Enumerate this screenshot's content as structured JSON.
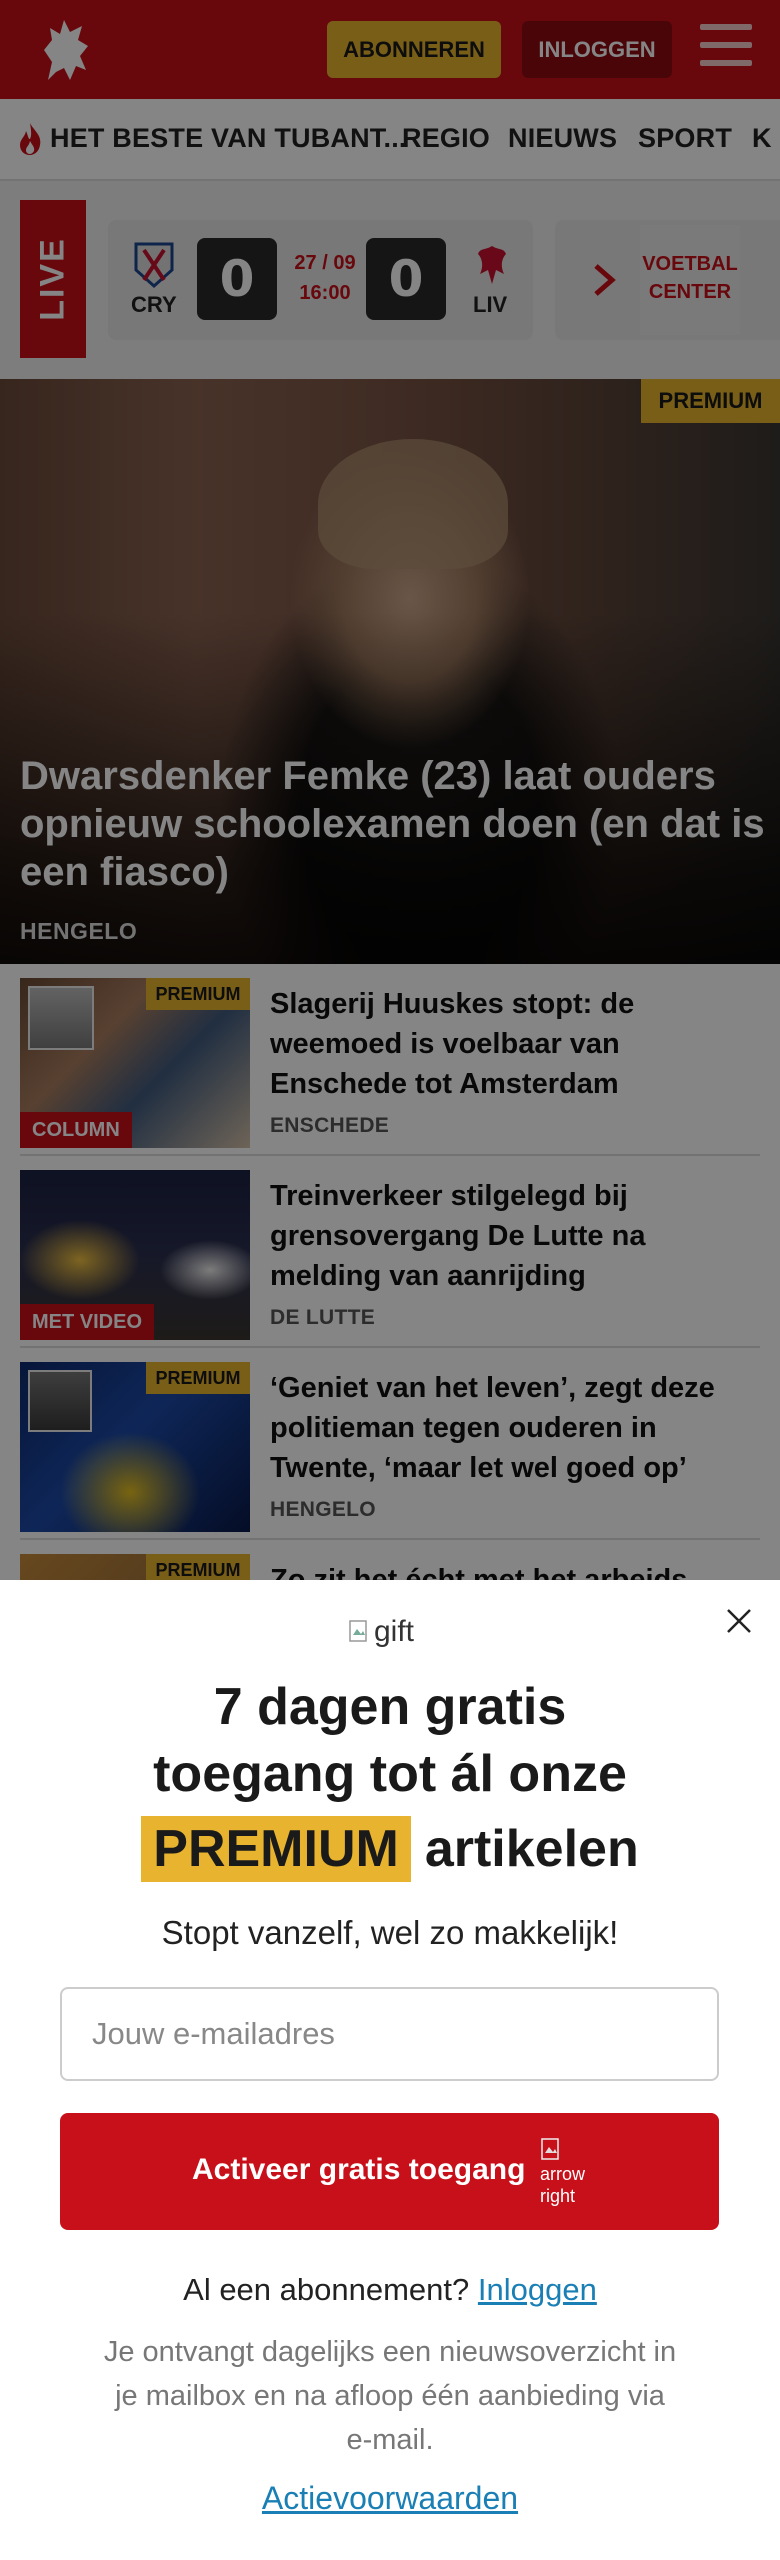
{
  "header": {
    "subscribe_label": "ABONNEREN",
    "login_label": "INLOGGEN",
    "brand_color": "#c8101a"
  },
  "nav": {
    "items": [
      "HET BESTE VAN TUBANT...",
      "REGIO",
      "NIEUWS",
      "SPORT",
      "K"
    ]
  },
  "live": {
    "tag": "LIVE",
    "match": {
      "home_code": "CRY",
      "home_score": "0",
      "date": "27 / 09",
      "time": "16:00",
      "away_score": "0",
      "away_code": "LIV"
    },
    "voetbal_center": [
      "VOETBAL",
      "CENTER"
    ]
  },
  "hero": {
    "badge": "PREMIUM",
    "title": "Dwarsdenker Femke (23) laat ouders opnieuw schoolexamen doen (en dat is een fiasco)",
    "kicker": "HENGELO"
  },
  "articles": [
    {
      "badge": "PREMIUM",
      "label": "COLUMN",
      "title": "Slagerij Huuskes stopt: de weemoed is voelbaar van Enschede tot Amsterdam",
      "kicker": "ENSCHEDE"
    },
    {
      "badge": "",
      "label": "MET VIDEO",
      "title": "Treinverkeer stilgelegd bij grensovergang De Lutte na melding van aanrijding",
      "kicker": "DE LUTTE"
    },
    {
      "badge": "PREMIUM",
      "label": "",
      "title": "‘Geniet van het leven’, zegt deze politieman tegen ouderen in Twente, ‘maar let wel goed op’",
      "kicker": "HENGELO"
    },
    {
      "badge": "PREMIUM",
      "label": "",
      "title": "Zo zit het écht met het arbeids",
      "kicker": ""
    }
  ],
  "modal": {
    "gift_alt": "gift",
    "heading_line1": "7 dagen gratis",
    "heading_line2": "toegang tot ál onze",
    "heading_premium": "PREMIUM",
    "heading_rest": "artikelen",
    "subheading": "Stopt vanzelf, wel zo makkelijk!",
    "email_placeholder": "Jouw e-mailadres",
    "cta_label": "Activeer gratis toegang",
    "cta_arrow_alt": "arrow right",
    "have_sub_text": "Al een abonnement?",
    "have_sub_link": "Inloggen",
    "fineprint": "Je ontvangt dagelijks een nieuwsoverzicht in je mailbox en na afloop één aanbieding via e-mail.",
    "terms": "Actievoorwaarden"
  }
}
